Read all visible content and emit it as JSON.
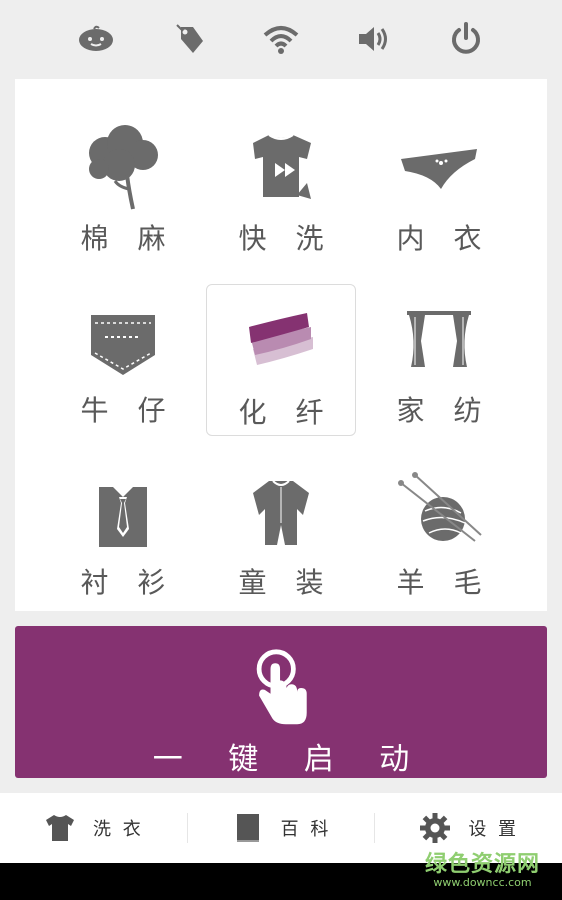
{
  "status_icons": [
    "baby-face-icon",
    "price-tag-icon",
    "wifi-icon",
    "volume-icon",
    "power-icon"
  ],
  "programs": [
    {
      "label": "棉 麻",
      "icon": "cotton-plant-icon",
      "selected": false
    },
    {
      "label": "快 洗",
      "icon": "tshirt-fast-forward-icon",
      "selected": false
    },
    {
      "label": "内 衣",
      "icon": "underwear-icon",
      "selected": false
    },
    {
      "label": "牛 仔",
      "icon": "jeans-pocket-icon",
      "selected": false
    },
    {
      "label": "化 纤",
      "icon": "fabric-layers-icon",
      "selected": true
    },
    {
      "label": "家 纺",
      "icon": "curtains-icon",
      "selected": false
    },
    {
      "label": "衬 衫",
      "icon": "shirt-tie-icon",
      "selected": false
    },
    {
      "label": "童 装",
      "icon": "baby-romper-icon",
      "selected": false
    },
    {
      "label": "羊 毛",
      "icon": "yarn-ball-icon",
      "selected": false
    }
  ],
  "start_button": {
    "label": "一 键 启 动",
    "icon": "touch-hand-icon"
  },
  "tabs": [
    {
      "label": "洗 衣",
      "icon": "tshirt-icon"
    },
    {
      "label": "百 科",
      "icon": "book-icon"
    },
    {
      "label": "设 置",
      "icon": "gear-icon"
    }
  ],
  "watermark": {
    "line1": "绿色资源网",
    "line2": "www.downcc.com"
  },
  "colors": {
    "accent": "#853271",
    "icon_gray": "#666666",
    "selected_accent": "#853271"
  }
}
